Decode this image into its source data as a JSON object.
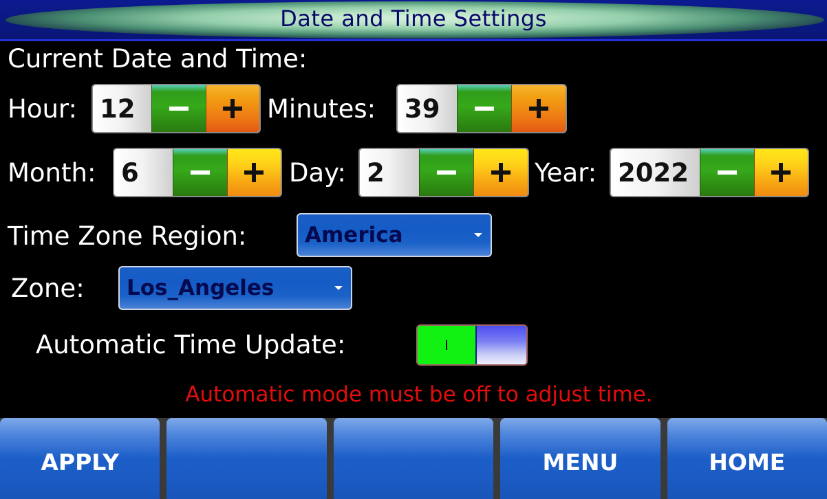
{
  "title": "Date and Time Settings",
  "section_label": "Current Date and Time:",
  "hour": {
    "label": "Hour:",
    "value": "12"
  },
  "minutes": {
    "label": "Minutes:",
    "value": "39"
  },
  "month": {
    "label": "Month:",
    "value": "6"
  },
  "day": {
    "label": "Day:",
    "value": "2"
  },
  "year": {
    "label": "Year:",
    "value": "2022"
  },
  "timezone_region": {
    "label": "Time Zone Region:",
    "value": "America"
  },
  "zone": {
    "label": "Zone:",
    "value": "Los_Angeles"
  },
  "auto_update": {
    "label": "Automatic Time Update:",
    "state": "on"
  },
  "warning": "Automatic mode must be off to adjust time.",
  "softkeys": [
    "APPLY",
    "",
    "",
    "MENU",
    "HOME"
  ],
  "colors": {
    "title_bar": "#0a1676",
    "minus_green": "#36a81a",
    "plus_orange": "#ef7e14",
    "dropdown_blue": "#155cc6",
    "toggle_green": "#12f212",
    "warning_red": "#e40c0c",
    "softkey_blue": "#1c5ec8"
  }
}
